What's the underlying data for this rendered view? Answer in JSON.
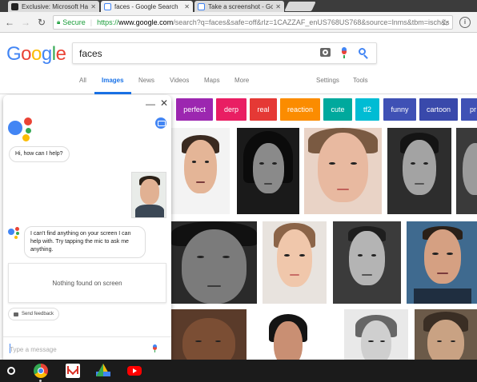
{
  "browser": {
    "tabs": [
      {
        "title": "Exclusive: Microsoft Ha"
      },
      {
        "title": "faces - Google Search"
      },
      {
        "title": "Take a screenshot - Goo"
      }
    ],
    "omnibox": {
      "secure_label": "Secure",
      "url_scheme": "https://",
      "url_host": "www.google.com",
      "url_rest": "/search?q=faces&safe=off&rlz=1CAZZAF_enUS768US768&source=lnms&tbm=isch&s"
    }
  },
  "google": {
    "logo": [
      "G",
      "o",
      "o",
      "g",
      "l",
      "e"
    ],
    "search_query": "faces",
    "tabs": [
      "All",
      "Images",
      "News",
      "Videos",
      "Maps",
      "More"
    ],
    "settings_label": "Settings",
    "tools_label": "Tools",
    "chips": [
      {
        "label": "perfect",
        "color": "#9c27b0"
      },
      {
        "label": "derp",
        "color": "#e91e63"
      },
      {
        "label": "real",
        "color": "#e53935"
      },
      {
        "label": "reaction",
        "color": "#fb8c00"
      },
      {
        "label": "cute",
        "color": "#00a99d"
      },
      {
        "label": "tf2",
        "color": "#00bcd4"
      },
      {
        "label": "funny",
        "color": "#3f51b5"
      },
      {
        "label": "cartoon",
        "color": "#3949ab"
      },
      {
        "label": "pr",
        "color": "#3f51b5"
      }
    ]
  },
  "assistant": {
    "greeting": "Hi, how can I help?",
    "response": "I can't find anything on your screen I can help with. Try tapping the mic to ask me anything.",
    "nothing_found": "Nothing found on screen",
    "feedback_label": "Send feedback",
    "input_placeholder": "Type a message"
  },
  "colors": {
    "google_blue": "#4285f4",
    "google_red": "#ea4335",
    "google_yellow": "#fbbc05",
    "google_green": "#34a853"
  }
}
